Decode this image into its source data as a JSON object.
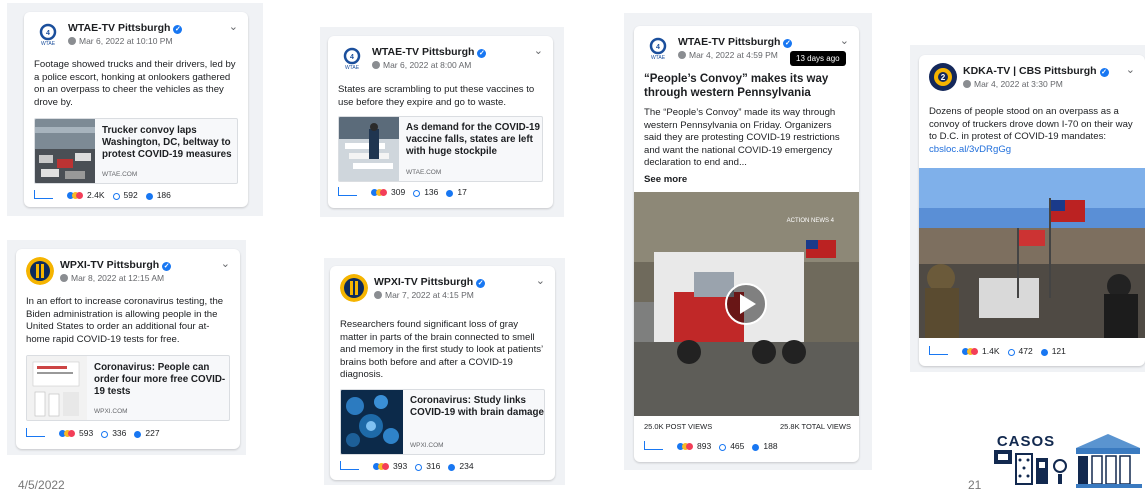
{
  "posts": [
    {
      "page": "WTAE-TV Pittsburgh",
      "date": "Mar 6, 2022 at 10:10 PM",
      "text": "Footage showed trucks and their drivers, led by a police escort, honking at onlookers gathered on an overpass to cheer the vehicles as they drove by.",
      "link_title": "Trucker convoy laps Washington, DC, beltway to protest COVID-19 measures",
      "link_domain": "WTAE.COM",
      "reactions": "2.4K",
      "comments": "592",
      "shares": "186"
    },
    {
      "page": "WTAE-TV Pittsburgh",
      "date": "Mar 6, 2022 at 8:00 AM",
      "text": "States are scrambling to put these vaccines to use before they expire and go to waste.",
      "link_title": "As demand for the COVID-19 vaccine falls, states are left with huge stockpile",
      "link_domain": "WTAE.COM",
      "reactions": "309",
      "comments": "136",
      "shares": "17"
    },
    {
      "page": "WTAE-TV Pittsburgh",
      "date": "Mar 4, 2022 at 4:59 PM",
      "tooltip": "13 days ago",
      "headline": "“People’s Convoy” makes its way through western Pennsylvania",
      "text": "The “People’s Convoy” made its way through western Pennsylvania on Friday. Organizers said they are protesting COVID-19 restrictions and want the national COVID-19 emergency declaration to end and...",
      "see_more": "See more",
      "video_watermark": "ACTION NEWS 4",
      "post_views": "25.0K POST VIEWS",
      "total_views": "25.8K TOTAL VIEWS",
      "reactions": "893",
      "comments": "465",
      "shares": "188"
    },
    {
      "page": "KDKA-TV | CBS Pittsburgh",
      "date": "Mar 4, 2022 at 3:30 PM",
      "text": "Dozens of people stood on an overpass as a convoy of truckers drove down I-70 on their way to D.C. in protest of COVID-19 mandates:",
      "link_url": "cbsloc.al/3vDRgGg",
      "reactions": "1.4K",
      "comments": "472",
      "shares": "121"
    },
    {
      "page": "WPXI-TV Pittsburgh",
      "date": "Mar 8, 2022 at 12:15 AM",
      "text": "In an effort to increase coronavirus testing, the Biden administration is allowing people in the United States to order an additional four at-home rapid COVID-19 tests for free.",
      "link_title": "Coronavirus: People can order four more free COVID-19 tests",
      "link_domain": "WPXI.COM",
      "reactions": "593",
      "comments": "336",
      "shares": "227"
    },
    {
      "page": "WPXI-TV Pittsburgh",
      "date": "Mar 7, 2022 at 4:15 PM",
      "text": "Researchers found significant loss of gray matter in parts of the brain connected to smell and memory in the first study to look at patients’ brains both before and after a COVID-19 diagnosis.",
      "link_title": "Coronavirus: Study links COVID-19 with brain damage",
      "link_domain": "WPXI.COM",
      "reactions": "393",
      "comments": "316",
      "shares": "234"
    }
  ],
  "logos": {
    "wtae": "WTAE",
    "kdka": "2"
  },
  "casos_logo": "CASOS",
  "footer": {
    "date": "4/5/2022",
    "page_number": "21"
  },
  "colors": {
    "fb_blue": "#1877f2",
    "wpxi_yellow": "#f5b400",
    "wtae_blue": "#1b4f9c",
    "kdka_navy": "#14285a"
  }
}
